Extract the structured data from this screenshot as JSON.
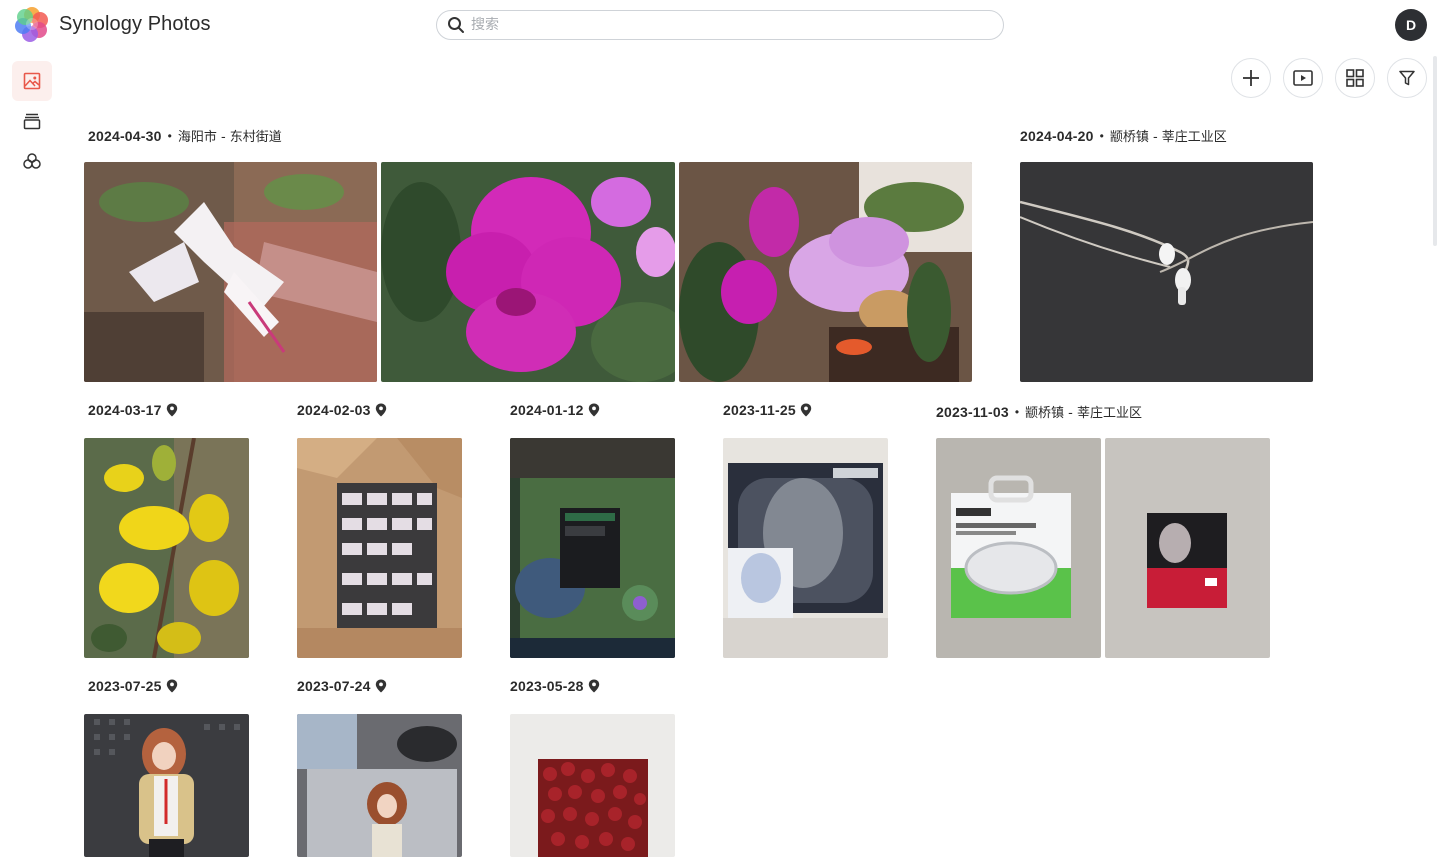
{
  "app": {
    "title": "Synology Photos",
    "avatar_initial": "D"
  },
  "search": {
    "placeholder": "搜索",
    "value": ""
  },
  "sidebar": {
    "items": [
      {
        "name": "photos",
        "icon": "image-icon",
        "active": true
      },
      {
        "name": "albums",
        "icon": "albums-icon",
        "active": false
      },
      {
        "name": "shared",
        "icon": "shared-icon",
        "active": false
      }
    ]
  },
  "toolbar": {
    "buttons": [
      {
        "icon": "plus-icon"
      },
      {
        "icon": "slideshow-icon"
      },
      {
        "icon": "grid-view-icon"
      },
      {
        "icon": "filter-icon"
      }
    ]
  },
  "colors": {
    "accent": "#e8584a",
    "text": "#2b2b2b",
    "border": "#dfe2e6"
  },
  "groups": [
    {
      "date": "2024-04-30",
      "location": "海阳市 - 东村街道",
      "has_pin": false,
      "photos": 3
    },
    {
      "date": "2024-04-20",
      "location": "颛桥镇 - 莘庄工业区",
      "has_pin": false,
      "photos": 1
    },
    {
      "date": "2024-03-17",
      "location": "",
      "has_pin": true,
      "photos": 1
    },
    {
      "date": "2024-02-03",
      "location": "",
      "has_pin": true,
      "photos": 1
    },
    {
      "date": "2024-01-12",
      "location": "",
      "has_pin": true,
      "photos": 1
    },
    {
      "date": "2023-11-25",
      "location": "",
      "has_pin": true,
      "photos": 1
    },
    {
      "date": "2023-11-03",
      "location": "颛桥镇 - 莘庄工业区",
      "has_pin": false,
      "photos": 2
    },
    {
      "date": "2023-07-25",
      "location": "",
      "has_pin": true,
      "photos": 1
    },
    {
      "date": "2023-07-24",
      "location": "",
      "has_pin": true,
      "photos": 1
    },
    {
      "date": "2023-05-28",
      "location": "",
      "has_pin": true,
      "photos": 1
    }
  ]
}
